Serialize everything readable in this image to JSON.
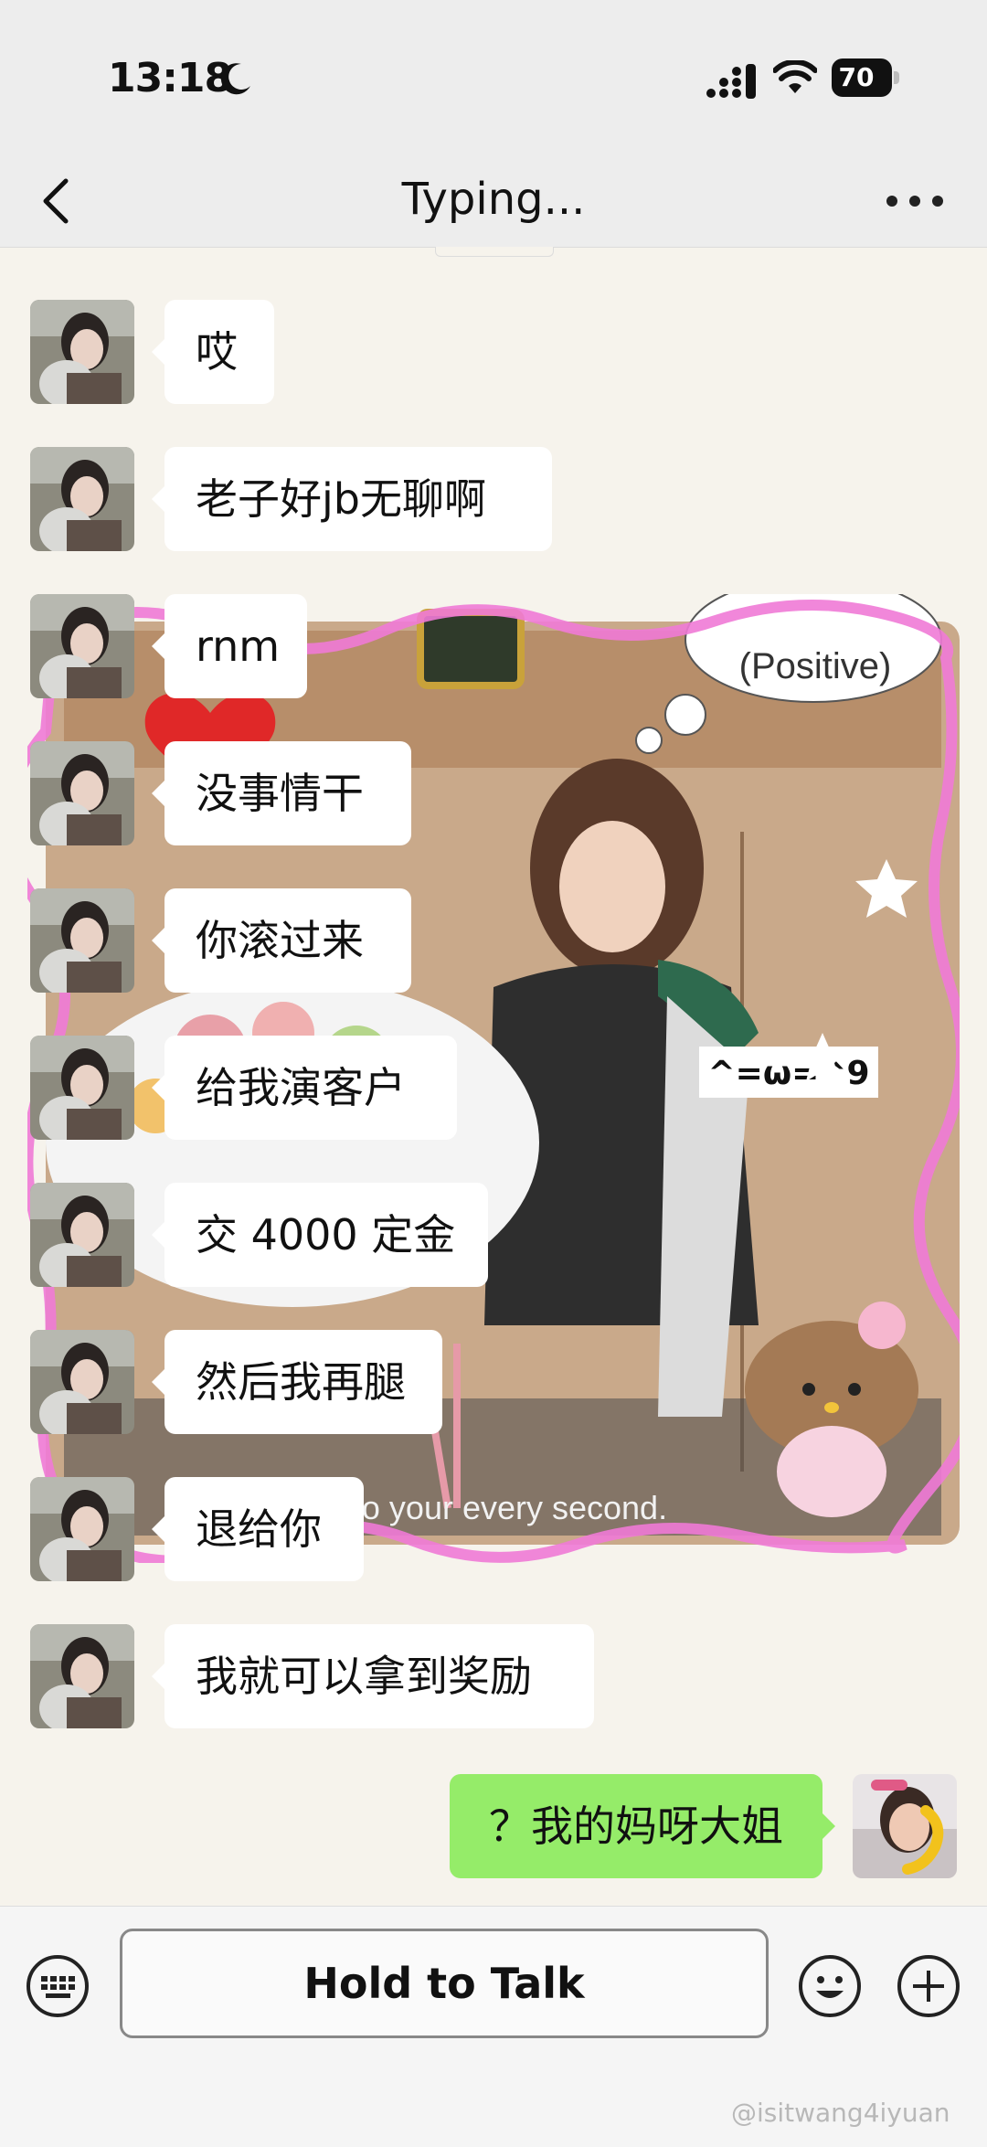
{
  "status_bar": {
    "time": "13:18",
    "battery": "70"
  },
  "nav": {
    "title": "Typing..."
  },
  "sticker": {
    "caption": "Do your every second.",
    "thought_bubble": "(Positive)",
    "emoticon": "^=ω=^9"
  },
  "messages": [
    {
      "text": "哎"
    },
    {
      "text": "老子好jb无聊啊"
    },
    {
      "text": "rnm"
    },
    {
      "text": "没事情干"
    },
    {
      "text": "你滚过来"
    },
    {
      "text": "给我演客户"
    },
    {
      "text": "交 4000 定金"
    },
    {
      "text": "然后我再腿"
    },
    {
      "text": "退给你"
    },
    {
      "text": "我就可以拿到奖励"
    }
  ],
  "my_message": {
    "text": "？我的妈呀大姐"
  },
  "input_bar": {
    "hold_to_talk": "Hold to Talk"
  },
  "watermark": "@isitwang4iyuan",
  "colors": {
    "my_bubble": "#95EC69",
    "their_bubble": "#FFFFFF",
    "background": "#F6F3EC"
  }
}
